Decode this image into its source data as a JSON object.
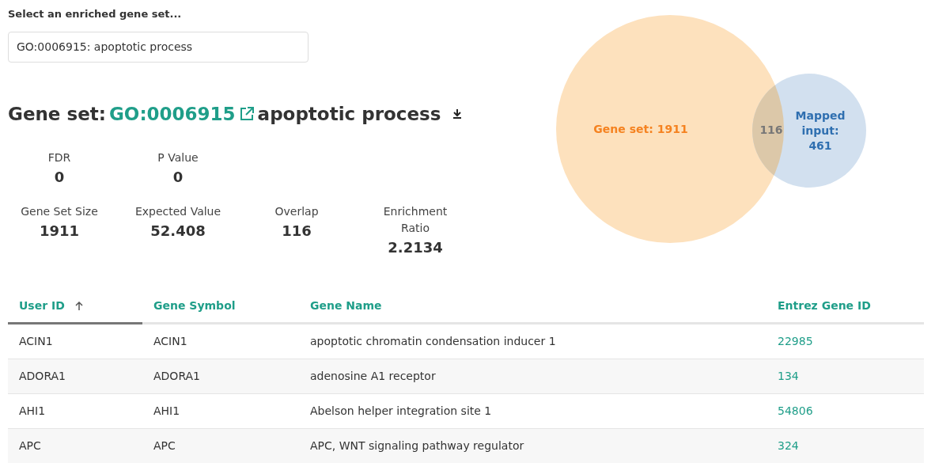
{
  "selector": {
    "label": "Select an enriched gene set...",
    "value": "GO:0006915: apoptotic process"
  },
  "gene_set": {
    "prefix": "Gene set:",
    "id": "GO:0006915",
    "name": "apoptotic process"
  },
  "stats": [
    [
      {
        "label": "FDR",
        "value": "0"
      },
      {
        "label": "P Value",
        "value": "0"
      }
    ],
    [
      {
        "label": "Gene Set Size",
        "value": "1911"
      },
      {
        "label": "Expected Value",
        "value": "52.408"
      },
      {
        "label": "Overlap",
        "value": "116"
      },
      {
        "label": "Enrichment Ratio",
        "value": "2.2134"
      }
    ]
  ],
  "venn": {
    "sets": [
      {
        "label": "Gene set: 1911",
        "color": "#fde1bd"
      },
      {
        "label": "Mapped input: 461",
        "color": "#d2e0ef"
      }
    ],
    "overlap": "116"
  },
  "table": {
    "columns": [
      {
        "label": "User ID",
        "selected": true
      },
      {
        "label": "Gene Symbol",
        "selected": false
      },
      {
        "label": "Gene Name",
        "selected": false
      },
      {
        "label": "Entrez Gene ID",
        "selected": false
      }
    ],
    "rows": [
      [
        "ACIN1",
        "ACIN1",
        "apoptotic chromatin condensation inducer 1",
        "22985"
      ],
      [
        "ADORA1",
        "ADORA1",
        "adenosine A1 receptor",
        "134"
      ],
      [
        "AHI1",
        "AHI1",
        "Abelson helper integration site 1",
        "54806"
      ],
      [
        "APC",
        "APC",
        "APC, WNT signaling pathway regulator",
        "324"
      ]
    ]
  }
}
